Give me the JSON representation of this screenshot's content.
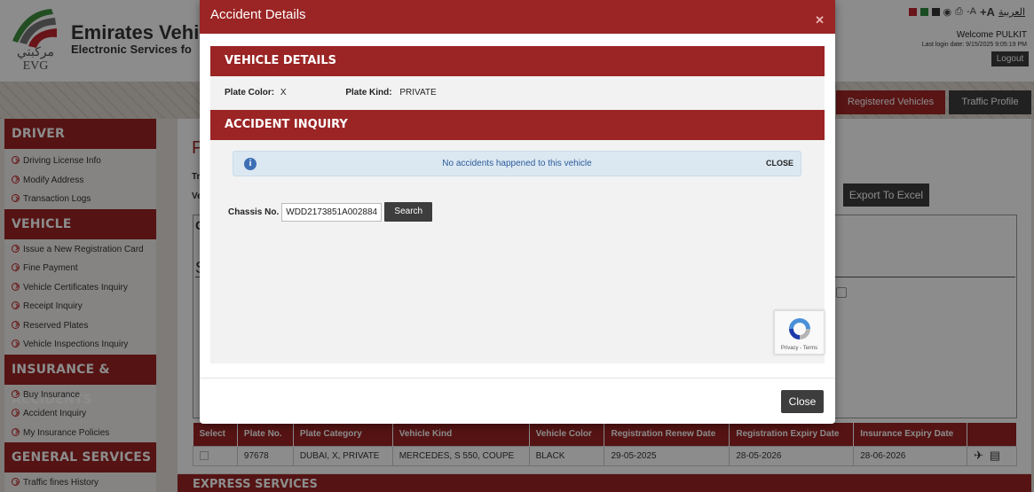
{
  "header": {
    "brand_title": "Emirates Vehi",
    "brand_subtitle": "Electronic Services fo",
    "logo_arabic": "مركبتي",
    "logo_text": "EVG",
    "arabic_link": "العربية",
    "font_small": "-A",
    "font_large": "+A",
    "welcome": "Welcome  PULKIT",
    "last_login": "Last login date: 9/15/2025 9:05:19 PM",
    "logout": "Logout",
    "theme_colors": [
      "#c0262d",
      "#2e8b3c",
      "#333333"
    ]
  },
  "nav_tabs": {
    "registered": "Registered Vehicles",
    "traffic": "Traffic Profile"
  },
  "sidebar": {
    "driver_title": "DRIVER",
    "driver_items": [
      "Driving License Info",
      "Modify Address",
      "Transaction Logs"
    ],
    "vehicle_title": "VEHICLE",
    "vehicle_items": [
      "Issue a New Registration Card",
      "Fine Payment",
      "Vehicle Certificates Inquiry",
      "Receipt Inquiry",
      "Reserved Plates",
      "Vehicle Inspections Inquiry"
    ],
    "insurance_title": "INSURANCE & ACCIDENTS",
    "insurance_items": [
      "Buy Insurance",
      "Accident Inquiry",
      "My Insurance Policies"
    ],
    "general_title": "GENERAL SERVICES",
    "general_items": [
      "Traffic fines History"
    ]
  },
  "content": {
    "export_btn": "Export To Excel",
    "express_title": "EXPRESS SERVICES",
    "frag_p": "P",
    "frag_s": "S",
    "frag_c": "C",
    "frag_tr": "Tr",
    "frag_ve": "Ve"
  },
  "table": {
    "headers": [
      "Select",
      "Plate No.",
      "Plate Category",
      "Vehicle Kind",
      "Vehicle Color",
      "Registration Renew Date",
      "Registration Expiry Date",
      "Insurance Expiry Date",
      ""
    ],
    "row": {
      "plate_no": "97678",
      "plate_category": "DUBAI, X, PRIVATE",
      "vehicle_kind": "MERCEDES, S 550, COUPE",
      "vehicle_color": "BLACK",
      "renew_date": "29-05-2025",
      "expiry_date": "28-05-2026",
      "insurance_expiry": "28-06-2026"
    }
  },
  "modal": {
    "title": "Accident Details",
    "vehicle_details_title": "VEHICLE DETAILS",
    "plate_color_label": "Plate Color:",
    "plate_color_value": "X",
    "plate_kind_label": "Plate Kind:",
    "plate_kind_value": "PRIVATE",
    "accident_inquiry_title": "ACCIDENT INQUIRY",
    "alert_message": "No accidents happened to this vehicle",
    "alert_close": "CLOSE",
    "chassis_label": "Chassis No.",
    "chassis_value": "WDD2173851A002884",
    "search_btn": "Search",
    "recaptcha_terms": "Privacy - Terms",
    "close_btn": "Close"
  }
}
